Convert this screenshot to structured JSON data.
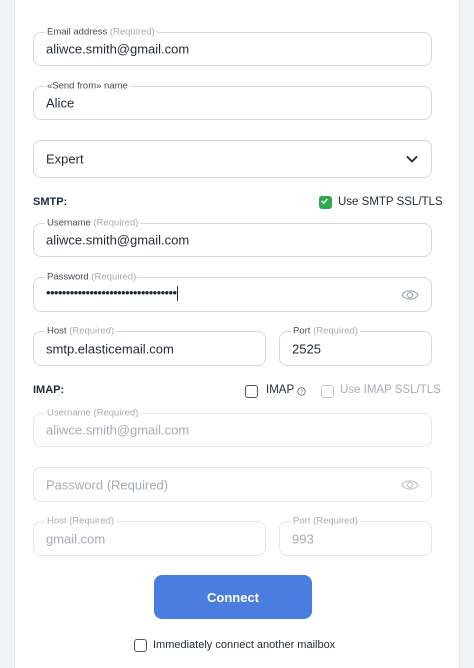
{
  "email": {
    "label": "Email address",
    "req": "(Required)",
    "value": "aliwce.smith@gmail.com"
  },
  "sender": {
    "label": "«Send from» name",
    "value": "Alice"
  },
  "mode": {
    "value": "Expert"
  },
  "smtp": {
    "section": "SMTP:",
    "ssl_label": "Use SMTP SSL/TLS",
    "ssl_checked": true,
    "username": {
      "label": "Username",
      "req": "(Required)",
      "value": "aliwce.smith@gmail.com"
    },
    "password": {
      "label": "Password",
      "req": "(Required)",
      "value": "•••••••••••••••••••••••••••••••••"
    },
    "host": {
      "label": "Host",
      "req": "(Required)",
      "value": "smtp.elasticemail.com"
    },
    "port": {
      "label": "Port",
      "req": "(Required)",
      "value": "2525"
    }
  },
  "imap": {
    "section": "IMAP:",
    "imap_label": "IMAP",
    "imap_checked": false,
    "ssl_label": "Use IMAP SSL/TLS",
    "ssl_checked": false,
    "username": {
      "label": "Username",
      "req": "(Required)",
      "value": "aliwce.smith@gmail.com"
    },
    "password": {
      "placeholder": "Password",
      "req": "(Required)"
    },
    "host": {
      "label": "Host",
      "req": "(Required)",
      "value": "gmail.com"
    },
    "port": {
      "label": "Port",
      "req": "(Required)",
      "value": "993"
    }
  },
  "connect_button": "Connect",
  "another_mailbox": {
    "label": "Immediately connect another mailbox",
    "checked": false
  },
  "colors": {
    "accent": "#4a7de0",
    "check_green": "#2fa84f"
  },
  "icons": {
    "mode_select": "chevron-down-icon",
    "password_toggle": "eye-icon",
    "imap_help": "question-circle-icon"
  }
}
